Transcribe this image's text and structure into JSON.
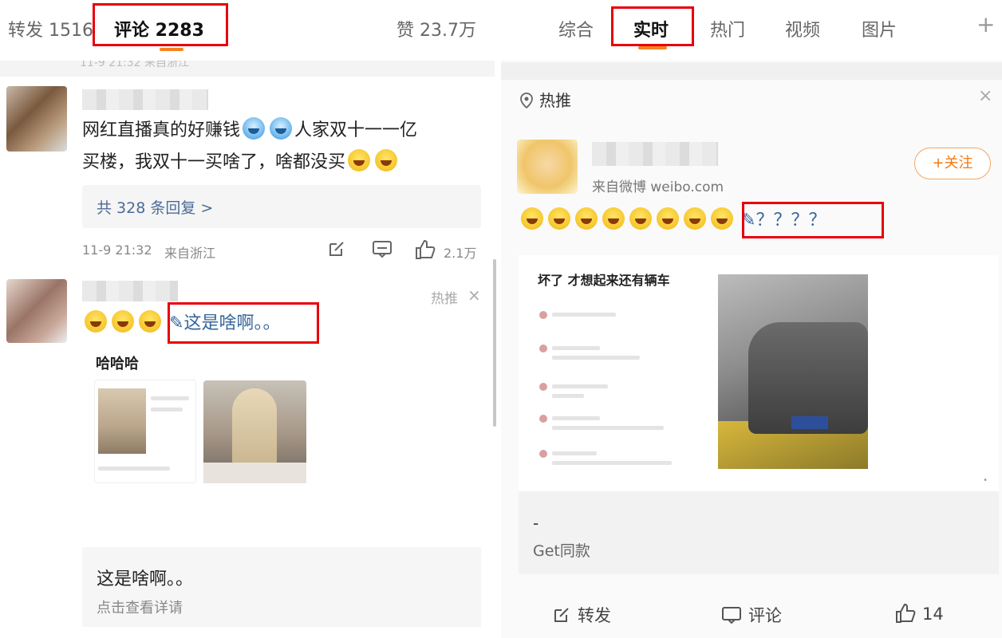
{
  "left": {
    "tabs": {
      "repost": "转发 1516",
      "comment": "评论 2283",
      "likes": "赞 23.7万"
    },
    "header_meta": "11-9 21:32 来自浙江",
    "comment1": {
      "text_a": "网红直播真的好赚钱",
      "text_b": "人家双十一一亿",
      "text_c": "买楼，我双十一买啥了，啥都没买",
      "replies": "共 328 条回复 >",
      "time": "11-9 21:32",
      "location": "来自浙江",
      "likes": "2.1万"
    },
    "comment2": {
      "hot_tag": "热推",
      "close": "×",
      "text": "这是啥啊。。",
      "card_title": "哈哈哈",
      "detail_title": "这是啥啊。。",
      "detail_sub": "点击查看详请"
    }
  },
  "right": {
    "tabs": [
      "综合",
      "实时",
      "热门",
      "视频",
      "图片"
    ],
    "active_tab": "实时",
    "plus": "+",
    "hot_head": "热推",
    "close": "×",
    "follow": "+关注",
    "source": "来自微博 weibo.com",
    "question_marks": "？？？？",
    "image_card": {
      "title": "坏了  才想起来还有辆车"
    },
    "get_dash": "-",
    "get_text": "Get同款",
    "actions": {
      "repost": "转发",
      "comment": "评论",
      "likes": "14"
    }
  },
  "colors": {
    "accent": "#f58220",
    "highlight_box": "#e8000a",
    "link_blue": "#35659b",
    "follow_orange": "#f07b12"
  },
  "icons": [
    "share-icon",
    "comment-icon",
    "thumbs-up-icon",
    "location-pin-icon",
    "close-icon",
    "plus-icon",
    "pen-icon"
  ]
}
